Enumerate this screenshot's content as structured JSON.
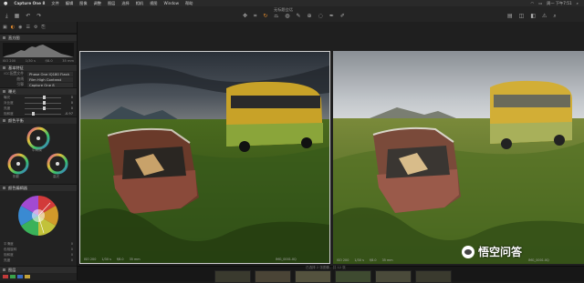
{
  "menubar": {
    "app": "Capture One 8",
    "items": [
      "文件",
      "编辑",
      "图像",
      "调整",
      "图层",
      "选择",
      "相机",
      "视图",
      "Window",
      "帮助"
    ],
    "right_status": "周一 下午7:51"
  },
  "toolbar": {
    "title": "无标题会话",
    "left_icons": [
      "import-icon",
      "grid-icon",
      "undo-icon",
      "redo-icon"
    ],
    "center_icons": [
      "pan-icon",
      "crop-icon",
      "rotate-icon",
      "keystone-icon",
      "mask-icon",
      "brush-icon",
      "picker-icon",
      "spot-icon",
      "wb-picker-icon",
      "annotate-icon"
    ],
    "right_icons": [
      "grid-view-icon",
      "proofing-icon",
      "before-after-icon",
      "exposure-warning-icon",
      "zoom-icon"
    ]
  },
  "left_panel": {
    "tabs": [
      "▣",
      "◐",
      "◉",
      "☰",
      "⚙",
      "⎘"
    ],
    "sections": {
      "histogram_title": "直方图",
      "exif": [
        "ISO 200",
        "1/30 s",
        "f/8.0",
        "35 mm"
      ],
      "base_title": "基本特征",
      "base_rows": [
        {
          "k": "ICC配置文件",
          "v": "Phase One IQ180 Flash"
        },
        {
          "k": "曲线",
          "v": "Film High Contrast"
        },
        {
          "k": "引擎",
          "v": "Capture One 8"
        }
      ],
      "exposure_title": "曝光",
      "exposure_rows": [
        {
          "k": "曝光",
          "v": "0"
        },
        {
          "k": "对比度",
          "v": "0"
        },
        {
          "k": "亮度",
          "v": "0"
        },
        {
          "k": "饱和度",
          "v": "-0.97"
        }
      ],
      "color_title": "颜色平衡",
      "wheel_labels": [
        "阴影",
        "中间调",
        "高光"
      ],
      "editor_title": "颜色编辑器",
      "editor_rows": [
        {
          "k": "平滑度",
          "v": "0"
        },
        {
          "k": "色相旋转",
          "v": "0"
        },
        {
          "k": "饱和度",
          "v": "0"
        },
        {
          "k": "亮度",
          "v": "0"
        }
      ],
      "layers_title": "图层"
    }
  },
  "viewer": {
    "left_photo": {
      "info": [
        "ISO 200",
        "1/30 s",
        "f/8.0",
        "35 mm"
      ],
      "name": "IMG_0001.IIQ"
    },
    "right_photo": {
      "info": [
        "ISO 200",
        "1/30 s",
        "f/8.0",
        "35 mm"
      ],
      "name": "IMG_0001.IIQ"
    },
    "status": "已选择 2 张图像，共 12 张"
  },
  "watermark": {
    "text": "悟空问答"
  },
  "colors": {
    "accent": "#e08a2e",
    "panel": "#222222",
    "background": "#1b1b1b"
  }
}
